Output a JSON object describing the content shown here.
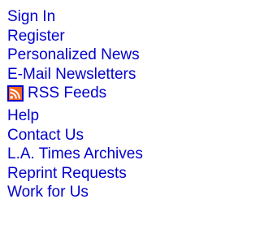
{
  "links": [
    {
      "label": "Sign In"
    },
    {
      "label": "Register"
    },
    {
      "label": "Personalized News"
    },
    {
      "label": "E-Mail Newsletters"
    },
    {
      "label": "RSS Feeds",
      "icon": "rss-icon"
    },
    {
      "label": "Help"
    },
    {
      "label": "Contact Us"
    },
    {
      "label": "L.A. Times Archives"
    },
    {
      "label": "Reprint Requests"
    },
    {
      "label": "Work for Us"
    }
  ],
  "colors": {
    "link": "#0000cc",
    "rss_orange": "#f26522"
  }
}
